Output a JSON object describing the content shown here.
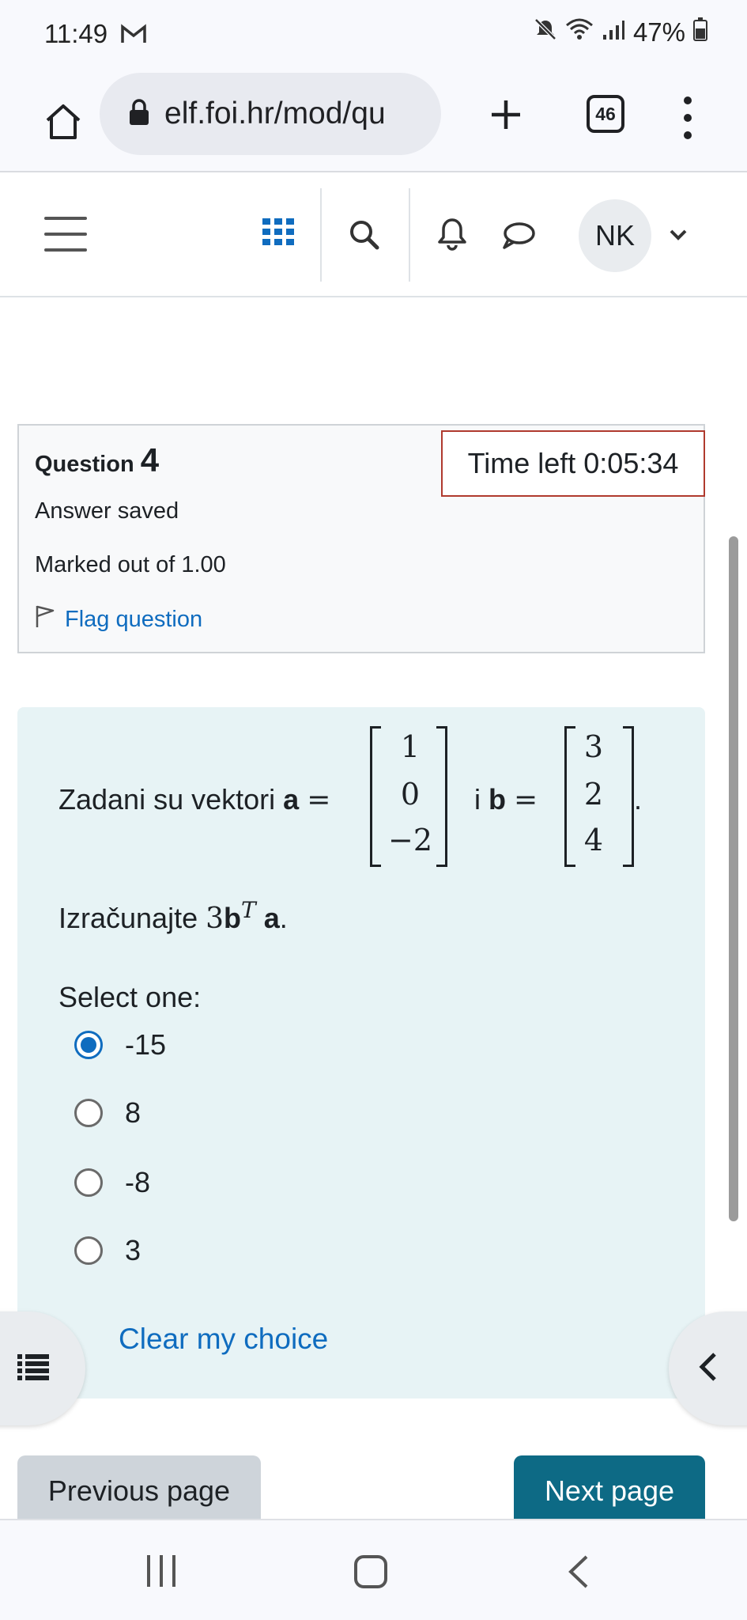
{
  "status_bar": {
    "time": "11:49",
    "battery": "47%",
    "icons": [
      "gmail-icon",
      "mute-icon",
      "wifi-icon",
      "signal-icon",
      "battery-icon"
    ]
  },
  "browser": {
    "url": "elf.foi.hr/mod/qu",
    "tab_count": "46",
    "icons": [
      "home-icon",
      "lock-icon",
      "plus-icon",
      "tabs-icon",
      "overflow-menu-icon"
    ]
  },
  "navbar": {
    "avatar_initials": "NK",
    "icons": [
      "hamburger-icon",
      "apps-grid-icon",
      "search-icon",
      "bell-icon",
      "chat-icon",
      "chevron-down-icon"
    ]
  },
  "question_info": {
    "title_label": "Question",
    "number": "4",
    "state": "Answer saved",
    "mark": "Marked out of 1.00",
    "flag_label": "Flag question"
  },
  "timer": {
    "text": "Time left 0:05:34"
  },
  "question": {
    "intro": "Zadani su vektori",
    "var_a": "a",
    "equals": "=",
    "connector": "i",
    "var_b": "b",
    "vector_a": [
      "1",
      "0",
      "−2"
    ],
    "vector_b": [
      "3",
      "2",
      "4"
    ],
    "period": ".",
    "task_prefix": "Izračunajte",
    "task_coef": "3",
    "task_b": "b",
    "task_sup": "T",
    "task_a": "a",
    "task_end": ".",
    "select_label": "Select one:",
    "options": [
      {
        "label": "-15",
        "checked": true
      },
      {
        "label": "8",
        "checked": false
      },
      {
        "label": "-8",
        "checked": false
      },
      {
        "label": "3",
        "checked": false
      }
    ],
    "clear_label": "Clear my choice"
  },
  "navigation": {
    "previous_label": "Previous page",
    "next_label": "Next page"
  },
  "colors": {
    "link": "#0f6cbf",
    "question_bg": "#e7f3f5",
    "next_button": "#0d6a85",
    "timer_border": "#b03a2e"
  }
}
